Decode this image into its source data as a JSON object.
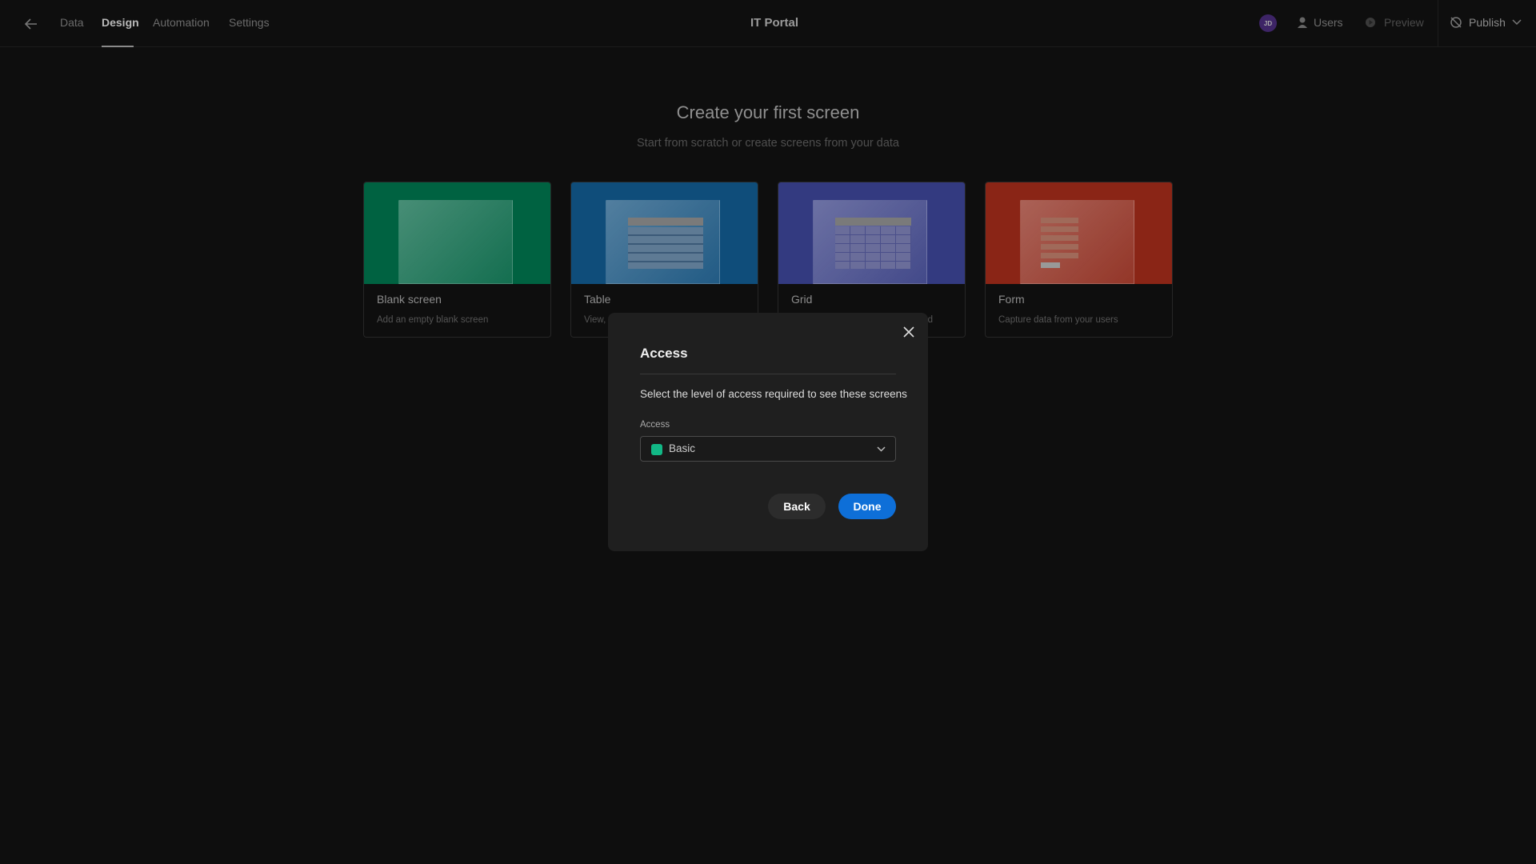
{
  "header": {
    "back_icon": "arrow-left-icon",
    "tabs": [
      {
        "label": "Data"
      },
      {
        "label": "Design",
        "active": true
      },
      {
        "label": "Automation"
      },
      {
        "label": "Settings"
      }
    ],
    "app_title": "IT Portal",
    "avatar_initials": "JD",
    "users_label": "Users",
    "preview_label": "Preview",
    "publish_label": "Publish"
  },
  "main": {
    "title": "Create your first screen",
    "subtitle": "Start from scratch or create screens from your data",
    "cards": [
      {
        "name": "Blank screen",
        "description": "Add an empty blank screen",
        "color": "#006241"
      },
      {
        "name": "Table",
        "description": "View,",
        "color": "#0f4d7a"
      },
      {
        "name": "Grid",
        "description": "d",
        "color": "#333a80"
      },
      {
        "name": "Form",
        "description": "Capture data from your users",
        "color": "#8a2516"
      }
    ]
  },
  "dialog": {
    "title": "Access",
    "description": "Select the level of access required to see these screens",
    "field_label": "Access",
    "selected_value": "Basic",
    "selected_color": "#12b886",
    "back_label": "Back",
    "done_label": "Done",
    "done_color": "#0e6fd8"
  }
}
